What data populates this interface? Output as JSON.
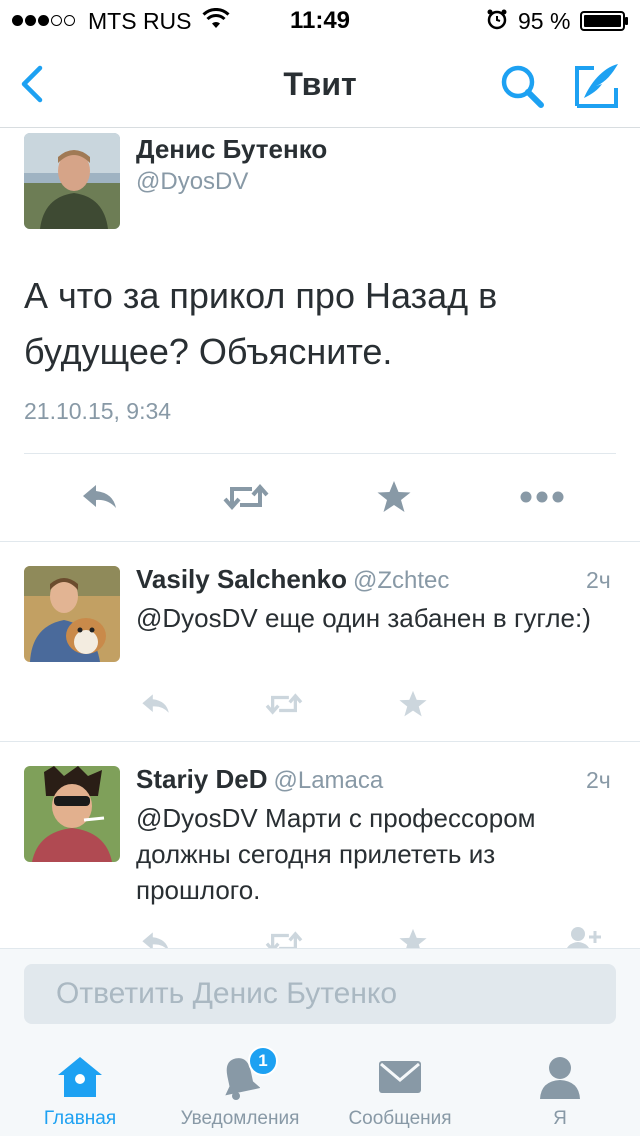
{
  "status_bar": {
    "carrier": "MTS RUS",
    "time": "11:49",
    "battery": "95 %",
    "signal_bars": 3
  },
  "nav": {
    "title": "Твит",
    "back_icon": "chevron-left-icon",
    "search_icon": "search-icon",
    "compose_icon": "compose-icon"
  },
  "main_tweet": {
    "author": "Денис Бутенко",
    "handle": "@DyosDV",
    "text": "А что за прикол про Назад в будущее? Объясните.",
    "timestamp": "21.10.15, 9:34"
  },
  "replies": [
    {
      "author": "Vasily Salchenko",
      "handle": "@Zchtec",
      "time": "2ч",
      "text": "@DyosDV еще один забанен в гугле:)"
    },
    {
      "author": "Stariy DeD",
      "handle": "@Lamaca",
      "time": "2ч",
      "text": "@DyosDV Марти с профессором должны сегодня прилететь из прошлого."
    }
  ],
  "reply_box": {
    "placeholder": "Ответить Денис Бутенко"
  },
  "tabs": [
    {
      "label": "Главная",
      "icon": "home-icon",
      "active": true
    },
    {
      "label": "Уведомления",
      "icon": "bell-icon",
      "badge": "1"
    },
    {
      "label": "Сообщения",
      "icon": "envelope-icon"
    },
    {
      "label": "Я",
      "icon": "person-icon"
    }
  ],
  "colors": {
    "accent": "#1da1f2",
    "text": "#292f33",
    "muted": "#8899a6",
    "action_icon": "#8899a6",
    "action_icon_light": "#ccd6dd"
  }
}
